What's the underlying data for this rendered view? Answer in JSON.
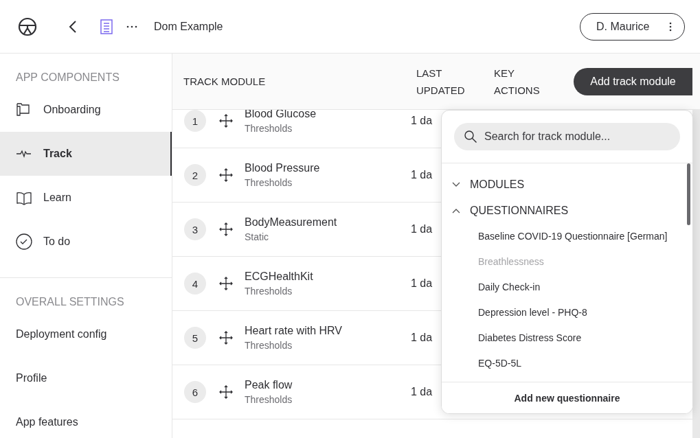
{
  "header": {
    "title": "Dom Example",
    "user": "D. Maurice"
  },
  "sidebar": {
    "sections": [
      {
        "title": "APP COMPONENTS",
        "items": [
          {
            "label": "Onboarding",
            "selected": false
          },
          {
            "label": "Track",
            "selected": true
          },
          {
            "label": "Learn",
            "selected": false
          },
          {
            "label": "To do",
            "selected": false
          }
        ]
      },
      {
        "title": "OVERALL SETTINGS",
        "items": [
          {
            "label": "Deployment config",
            "selected": false
          },
          {
            "label": "Profile",
            "selected": false
          },
          {
            "label": "App features",
            "selected": false
          }
        ]
      }
    ]
  },
  "table": {
    "columns": [
      "TRACK MODULE",
      "LAST UPDATED",
      "KEY ACTIONS"
    ],
    "add_button": "Add track module",
    "rows": [
      {
        "number": "1",
        "name": "Blood Glucose",
        "type": "Thresholds",
        "last_updated": "1 da"
      },
      {
        "number": "2",
        "name": "Blood Pressure",
        "type": "Thresholds",
        "last_updated": "1 da"
      },
      {
        "number": "3",
        "name": "BodyMeasurement",
        "type": "Static",
        "last_updated": "1 da"
      },
      {
        "number": "4",
        "name": "ECGHealthKit",
        "type": "Thresholds",
        "last_updated": "1 da"
      },
      {
        "number": "5",
        "name": "Heart rate with HRV",
        "type": "Thresholds",
        "last_updated": "1 da"
      },
      {
        "number": "6",
        "name": "Peak flow",
        "type": "Thresholds",
        "last_updated": "1 da"
      }
    ]
  },
  "popover": {
    "search": {
      "placeholder": "Search for track module..."
    },
    "groups": [
      {
        "title": "MODULES",
        "expanded": false
      },
      {
        "title": "QUESTIONNAIRES",
        "expanded": true,
        "items": [
          {
            "label": "Baseline COVID-19 Questionnaire [German]",
            "disabled": false
          },
          {
            "label": "Breathlessness",
            "disabled": true
          },
          {
            "label": "Daily Check-in",
            "disabled": false
          },
          {
            "label": "Depression level - PHQ-8",
            "disabled": false
          },
          {
            "label": "Diabetes Distress Score",
            "disabled": false
          },
          {
            "label": "EQ-5D-5L",
            "disabled": false
          }
        ]
      }
    ],
    "footer": "Add new questionnaire"
  }
}
